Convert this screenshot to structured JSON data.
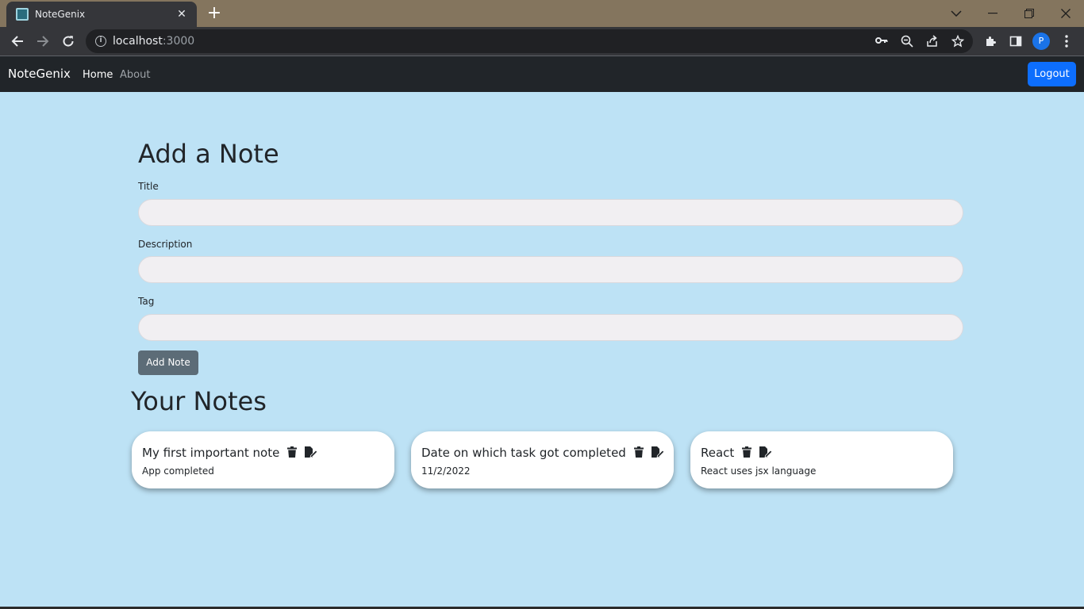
{
  "browser": {
    "tab_title": "NoteGenix",
    "url_host": "localhost",
    "url_port": ":3000",
    "profile_initial": "P"
  },
  "navbar": {
    "brand": "NoteGenix",
    "links": [
      {
        "label": "Home",
        "active": true
      },
      {
        "label": "About",
        "active": false
      }
    ],
    "logout_label": "Logout"
  },
  "form": {
    "heading": "Add a Note",
    "fields": [
      {
        "label": "Title",
        "value": ""
      },
      {
        "label": "Description",
        "value": ""
      },
      {
        "label": "Tag",
        "value": ""
      }
    ],
    "submit_label": "Add Note"
  },
  "notes": {
    "heading": "Your Notes",
    "items": [
      {
        "title": "My first important note",
        "description": "App completed"
      },
      {
        "title": "Date on which task got completed",
        "description": "11/2/2022"
      },
      {
        "title": "React",
        "description": "React uses jsx language"
      }
    ]
  },
  "colors": {
    "page_bg": "#bde2f5",
    "navbar_bg": "#212529",
    "logout_bg": "#0d6efd",
    "add_button_bg": "#5c6c77"
  }
}
